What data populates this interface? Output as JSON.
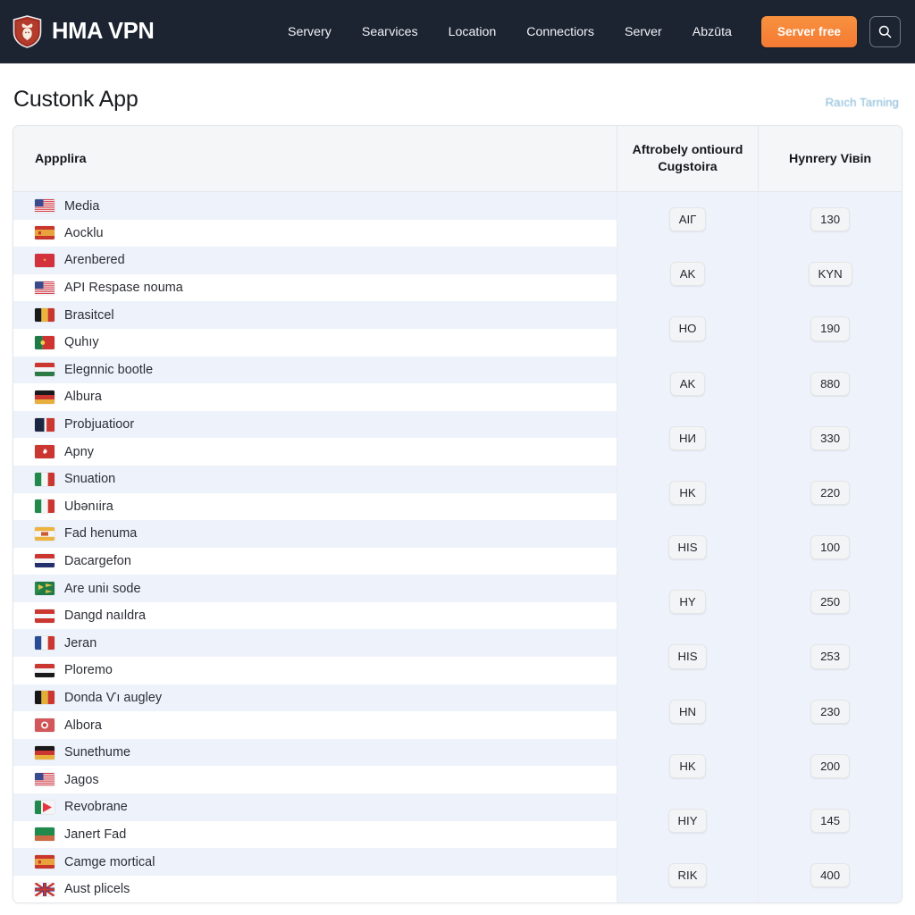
{
  "navbar": {
    "brand": "HMA VPN",
    "brand_logo_icon": "shield-donkey-logo-icon",
    "links": [
      {
        "label": "Servery"
      },
      {
        "label": "Seaгvices"
      },
      {
        "label": "Location"
      },
      {
        "label": "Connectiors"
      },
      {
        "label": "Server"
      },
      {
        "label": "Abzūta"
      }
    ],
    "cta_label": "Server free",
    "search_icon": "search-icon",
    "bg_color": "#1c2331",
    "cta_color": "#f5833a"
  },
  "page": {
    "title": "Custonk App",
    "link_label": "Raıch Tarning",
    "link_color": "#7fb6d6"
  },
  "table": {
    "headers": {
      "app": "Appplira",
      "middle_line1": "Aftrobely ontiourd",
      "middle_line2": "Cugstoira",
      "right": "Hynrery Viвin"
    },
    "rows": [
      {
        "flag": "us",
        "name": "Media",
        "mid": "AIГ",
        "right": "130"
      },
      {
        "flag": "es",
        "name": "Aocklu",
        "mid": "",
        "right": ""
      },
      {
        "flag": "cn",
        "name": "Arenbered",
        "mid": "AK",
        "right": "KYN"
      },
      {
        "flag": "us",
        "name": "API Respase nouma",
        "mid": "",
        "right": ""
      },
      {
        "flag": "be",
        "name": "Brasitcel",
        "mid": "HO",
        "right": "190"
      },
      {
        "flag": "pt",
        "name": "Quhıy",
        "mid": "",
        "right": ""
      },
      {
        "flag": "hu",
        "name": "Elegnnic bootle",
        "mid": "AK",
        "right": "880"
      },
      {
        "flag": "de",
        "name": "Albura",
        "mid": "",
        "right": ""
      },
      {
        "flag": "no",
        "name": "Probјuatioor",
        "mid": "HИ",
        "right": "330"
      },
      {
        "flag": "hk",
        "name": "Apny",
        "mid": "",
        "right": ""
      },
      {
        "flag": "it",
        "name": "Snuation",
        "mid": "HK",
        "right": "220"
      },
      {
        "flag": "it",
        "name": "Ubənıira",
        "mid": "",
        "right": ""
      },
      {
        "flag": "pf",
        "name": "Fad henuma",
        "mid": "HIS",
        "right": "100"
      },
      {
        "flag": "nl",
        "name": "Dacargefon",
        "mid": "",
        "right": ""
      },
      {
        "flag": "za",
        "name": "Are uniı sode",
        "mid": "HY",
        "right": "250"
      },
      {
        "flag": "at",
        "name": "Dangd naıldra",
        "mid": "",
        "right": ""
      },
      {
        "flag": "fr",
        "name": "Jeran",
        "mid": "HIS",
        "right": "253"
      },
      {
        "flag": "ye",
        "name": "Ploremo",
        "mid": "",
        "right": ""
      },
      {
        "flag": "be2",
        "name": "Donda Ѵı augley",
        "mid": "HN",
        "right": "230"
      },
      {
        "flag": "tn",
        "name": "Albora",
        "mid": "",
        "right": ""
      },
      {
        "flag": "de",
        "name": "Sunethume",
        "mid": "HK",
        "right": "200"
      },
      {
        "flag": "us",
        "name": "Jagos",
        "mid": "",
        "right": ""
      },
      {
        "flag": "pt2",
        "name": "Revobrane",
        "mid": "HIY",
        "right": "145"
      },
      {
        "flag": "dz",
        "name": "Janert Fad",
        "mid": "",
        "right": ""
      },
      {
        "flag": "es",
        "name": "Camge mortical",
        "mid": "RIK",
        "right": "400"
      },
      {
        "flag": "gb",
        "name": "Aust plicels",
        "mid": "",
        "right": ""
      }
    ]
  }
}
